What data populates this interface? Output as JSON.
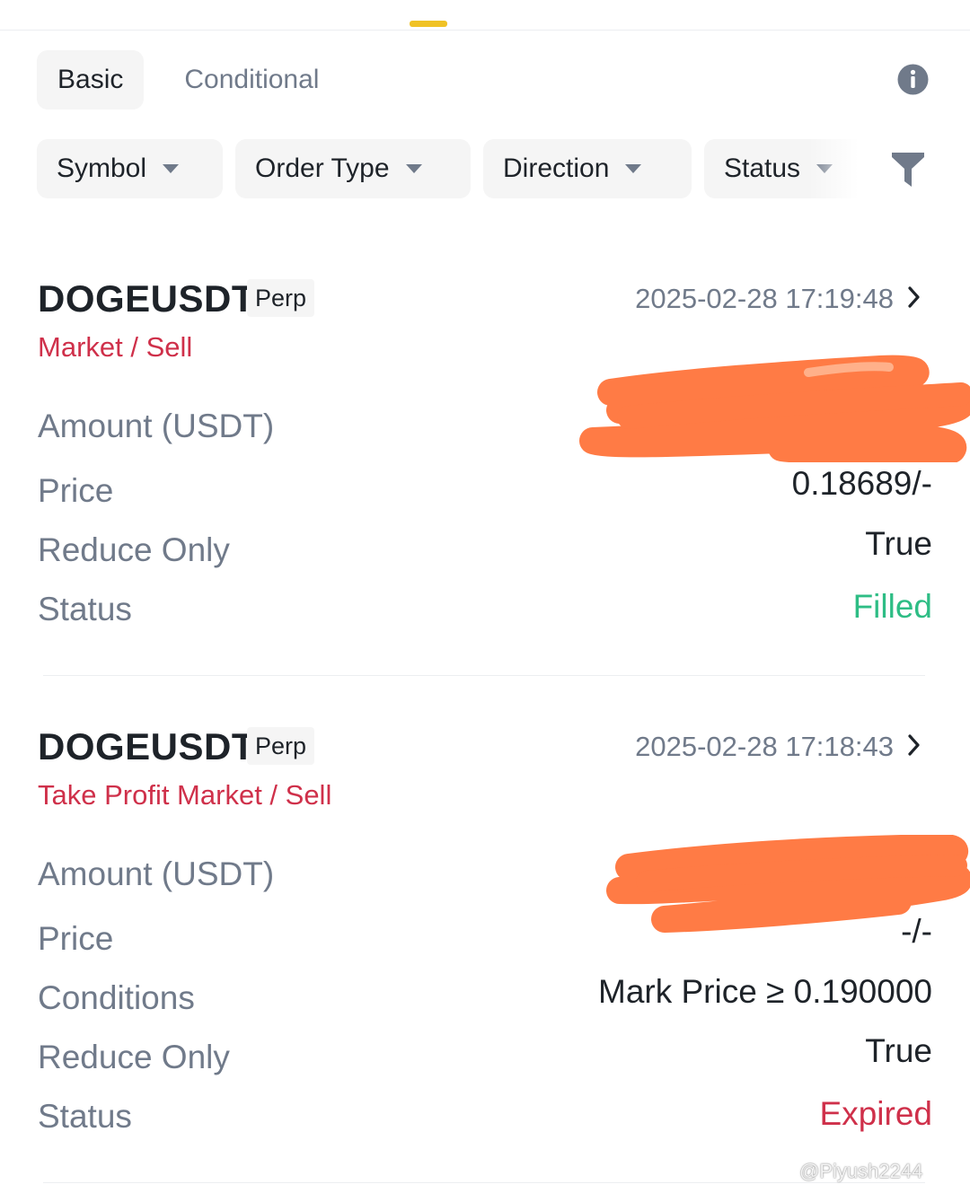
{
  "tabs": {
    "basic_label": "Basic",
    "conditional_label": "Conditional"
  },
  "filters": {
    "symbol": "Symbol",
    "order_type": "Order Type",
    "direction": "Direction",
    "status": "Status"
  },
  "orders": [
    {
      "symbol": "DOGEUSDT",
      "contract": "Perp",
      "time": "2025-02-28 17:19:48",
      "order_type": "Market / Sell",
      "amount_label": "Amount (USDT)",
      "amount_value": "",
      "price_label": "Price",
      "price_value": "0.18689/-",
      "reduce_label": "Reduce Only",
      "reduce_value": "True",
      "status_label": "Status",
      "status_value": "Filled"
    },
    {
      "symbol": "DOGEUSDT",
      "contract": "Perp",
      "time": "2025-02-28 17:18:43",
      "order_type": "Take Profit Market / Sell",
      "amount_label": "Amount (USDT)",
      "amount_value": "",
      "price_label": "Price",
      "price_value": "-/-",
      "conditions_label": "Conditions",
      "conditions_value": "Mark Price ≥ 0.190000",
      "reduce_label": "Reduce Only",
      "reduce_value": "True",
      "status_label": "Status",
      "status_value": "Expired"
    }
  ],
  "colors": {
    "accent": "#f0c226",
    "sell": "#cf304a",
    "filled": "#2ebd85",
    "expired": "#cf304a",
    "redaction": "#ff7b45"
  },
  "icons": {
    "info": "info-icon",
    "filter": "filter-icon",
    "chevron": "chevron-right-icon",
    "caret": "caret-down-icon"
  },
  "watermark": "@Piyush2244"
}
